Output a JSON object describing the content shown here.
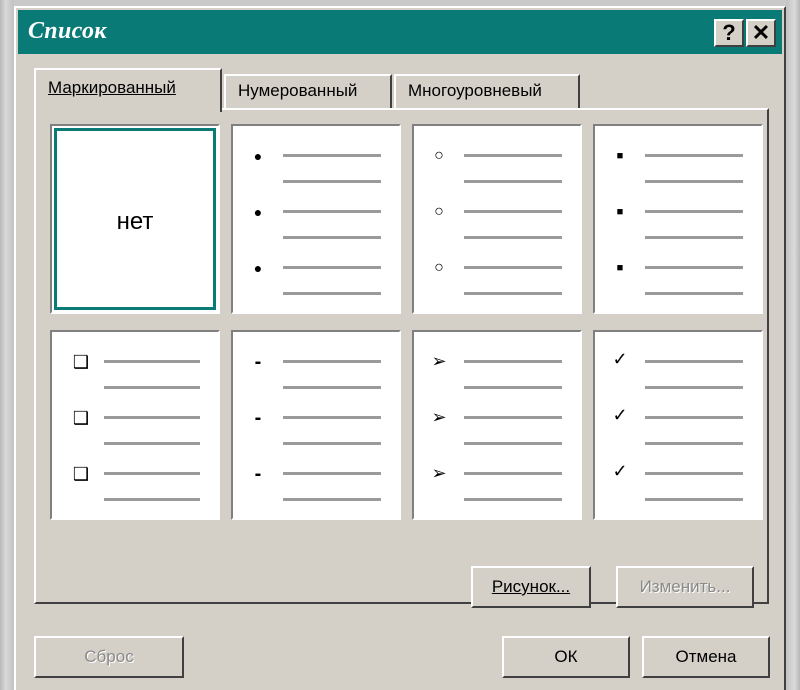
{
  "window": {
    "title": "Список",
    "help_label": "?",
    "close_label": "✕"
  },
  "tabs": [
    {
      "label": "Маркированный",
      "active": true
    },
    {
      "label": "Нумерованный",
      "active": false
    },
    {
      "label": "Многоуровневый",
      "active": false
    }
  ],
  "styles": [
    {
      "name": "none",
      "label": "нет",
      "selected": true
    },
    {
      "name": "filled-circle",
      "symbol": "●"
    },
    {
      "name": "hollow-circle",
      "symbol": "○"
    },
    {
      "name": "square",
      "symbol": "■"
    },
    {
      "name": "checkbox",
      "symbol": "❑"
    },
    {
      "name": "dash",
      "symbol": "-"
    },
    {
      "name": "arrowhead",
      "symbol": "➢"
    },
    {
      "name": "checkmark",
      "symbol": "✓"
    }
  ],
  "buttons": {
    "picture": "Рисунок...",
    "modify": "Изменить...",
    "reset": "Сброс",
    "ok": "ОК",
    "cancel": "Отмена"
  },
  "colors": {
    "titlebar": "#0a7a76",
    "dialog_face": "#d4d0c8"
  }
}
